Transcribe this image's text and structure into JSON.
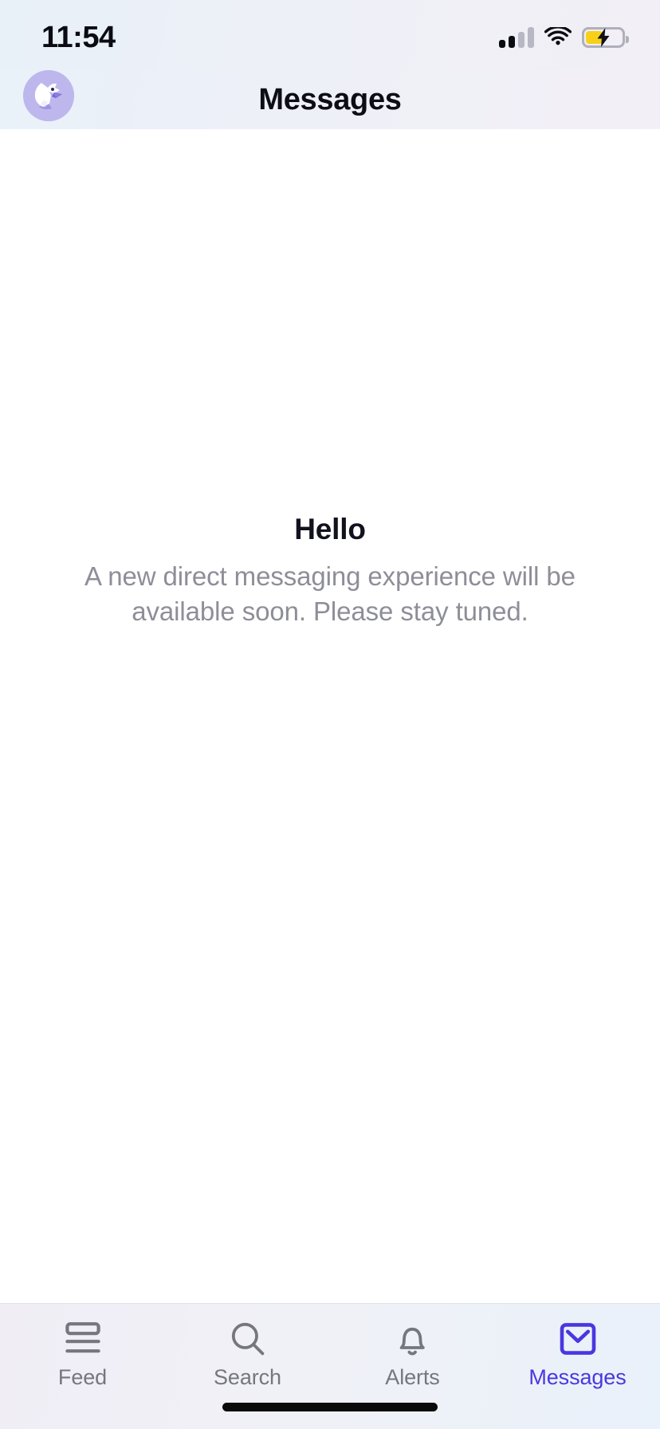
{
  "status_bar": {
    "time": "11:54",
    "cellular_icon": "cellular-signal-icon",
    "cellular_bars_filled": 2,
    "cellular_bars_total": 4,
    "wifi_icon": "wifi-icon",
    "battery_icon": "battery-charging-icon",
    "battery_level_percent": 44,
    "battery_charging": true,
    "battery_color": "#f7d117"
  },
  "nav_bar": {
    "avatar_icon": "eagle-avatar-icon",
    "title": "Messages"
  },
  "main": {
    "empty_state": {
      "title": "Hello",
      "subtitle": "A new direct messaging experience will be available soon. Please stay tuned."
    }
  },
  "tab_bar": {
    "active_color": "#4b37e0",
    "inactive_color": "#76767f",
    "tabs": [
      {
        "label": "Feed",
        "icon": "feed-icon",
        "active": false
      },
      {
        "label": "Search",
        "icon": "search-icon",
        "active": false
      },
      {
        "label": "Alerts",
        "icon": "bell-icon",
        "active": false
      },
      {
        "label": "Messages",
        "icon": "envelope-icon",
        "active": true
      }
    ]
  },
  "home_indicator": "home-indicator"
}
